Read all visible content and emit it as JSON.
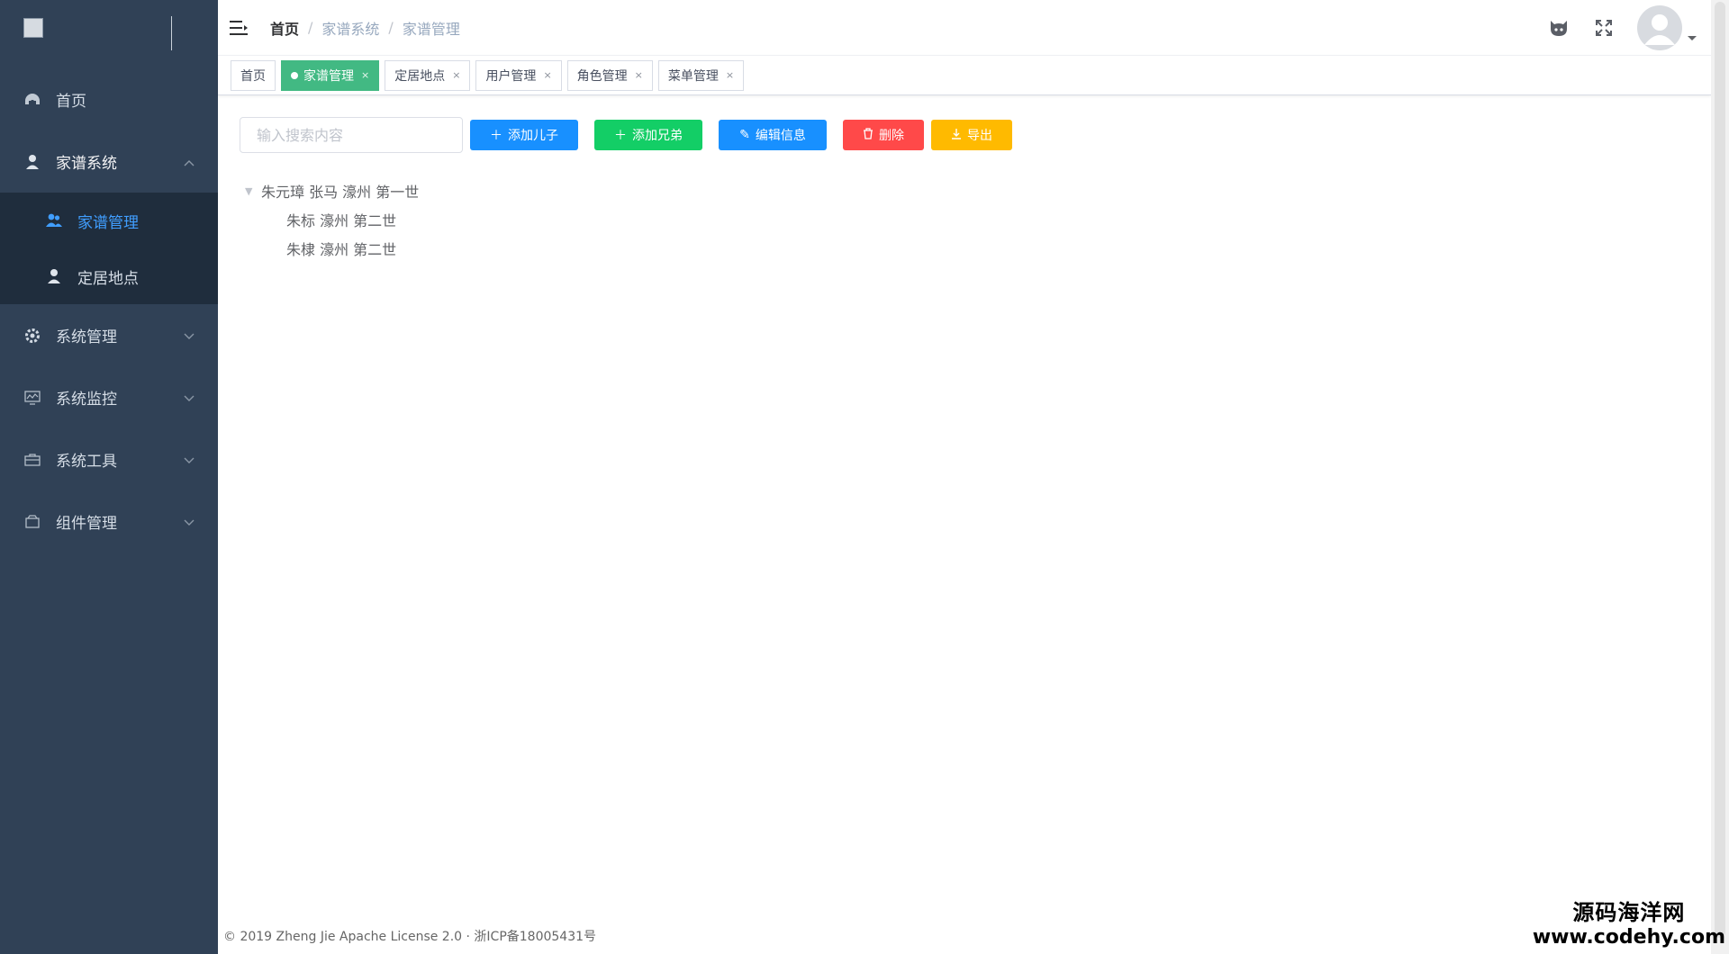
{
  "sidebar": {
    "items": [
      {
        "label": "首页",
        "icon": "dashboard-icon"
      },
      {
        "label": "家谱系统",
        "icon": "user-tree-icon",
        "expanded": true,
        "children": [
          {
            "label": "家谱管理",
            "icon": "people-icon",
            "active": true
          },
          {
            "label": "定居地点",
            "icon": "location-person-icon"
          }
        ]
      },
      {
        "label": "系统管理",
        "icon": "gear-icon"
      },
      {
        "label": "系统监控",
        "icon": "monitor-icon"
      },
      {
        "label": "系统工具",
        "icon": "tool-icon"
      },
      {
        "label": "组件管理",
        "icon": "component-icon"
      }
    ]
  },
  "breadcrumb": {
    "home": "首页",
    "level1": "家谱系统",
    "level2": "家谱管理"
  },
  "tags": [
    {
      "label": "首页",
      "active": false,
      "closable": false
    },
    {
      "label": "家谱管理",
      "active": true,
      "closable": true
    },
    {
      "label": "定居地点",
      "active": false,
      "closable": true
    },
    {
      "label": "用户管理",
      "active": false,
      "closable": true
    },
    {
      "label": "角色管理",
      "active": false,
      "closable": true
    },
    {
      "label": "菜单管理",
      "active": false,
      "closable": true
    }
  ],
  "toolbar": {
    "search_placeholder": "输入搜索内容",
    "add_child": "添加儿子",
    "add_sibling": "添加兄弟",
    "edit": "编辑信息",
    "delete": "删除",
    "export": "导出"
  },
  "tree": {
    "root": "朱元璋 张马 濠州 第一世",
    "children": [
      "朱标 濠州 第二世",
      "朱棣 濠州 第二世"
    ]
  },
  "footer": "© 2019 Zheng Jie Apache License 2.0 · 浙ICP备18005431号",
  "watermark": {
    "cn": "源码海洋网",
    "url": "www.codehy.com"
  },
  "colors": {
    "sidebar_bg": "#304156",
    "submenu_bg": "#1f2d3d",
    "active_tag": "#42b983",
    "primary": "#1890ff",
    "success": "#13ce66",
    "danger": "#ff4949",
    "warning": "#ffba00"
  }
}
